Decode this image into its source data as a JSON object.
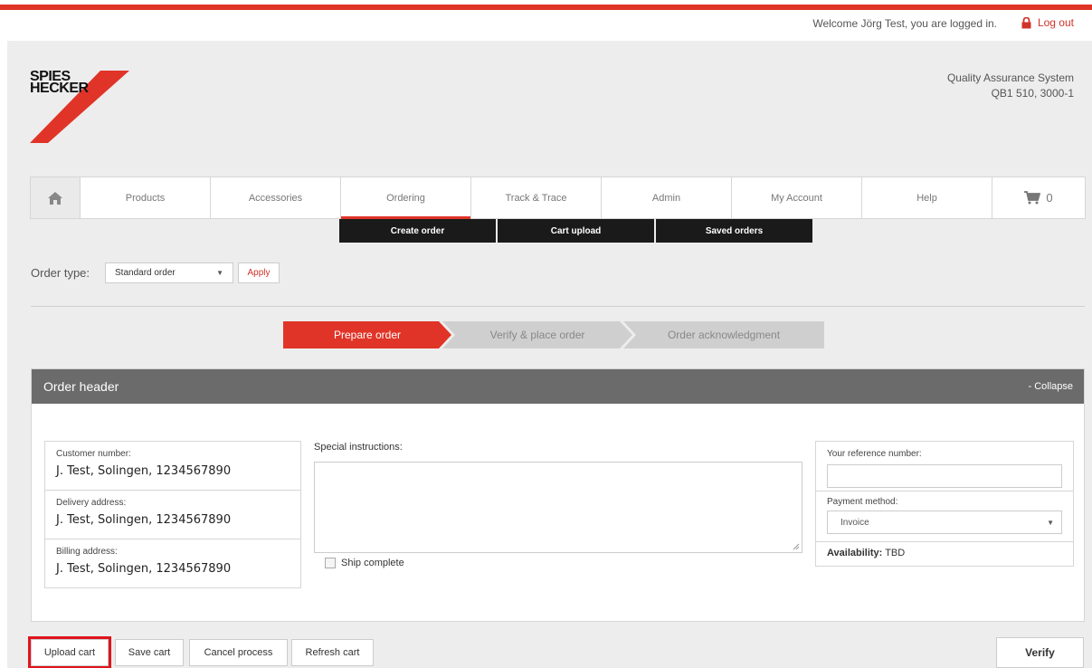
{
  "header": {
    "welcome_text": "Welcome Jörg Test, you are logged in.",
    "logout_label": "Log out",
    "system_title": "Quality Assurance System",
    "system_id": "QB1 510, 3000-1"
  },
  "logo": {
    "line1": "SPIES",
    "line2": "HECKER"
  },
  "nav": {
    "items": [
      "Products",
      "Accessories",
      "Ordering",
      "Track & Trace",
      "Admin",
      "My Account",
      "Help"
    ],
    "cart_count": "0"
  },
  "subnav": [
    "Create order",
    "Cart upload",
    "Saved orders"
  ],
  "order_type": {
    "label": "Order type:",
    "selected": "Standard order",
    "apply_label": "Apply"
  },
  "steps": [
    "Prepare order",
    "Verify & place order",
    "Order acknowledgment"
  ],
  "panel": {
    "title": "Order header",
    "collapse_label": "- Collapse",
    "customer_label": "Customer number:",
    "customer_value": "J. Test, Solingen, 1234567890",
    "delivery_label": "Delivery address:",
    "delivery_value": "J. Test, Solingen, 1234567890",
    "billing_label": "Billing address:",
    "billing_value": "J. Test, Solingen, 1234567890",
    "special_instructions_label": "Special instructions:",
    "ship_complete_label": "Ship complete",
    "reference_label": "Your reference number:",
    "payment_label": "Payment method:",
    "payment_selected": "Invoice",
    "availability_label": "Availability:",
    "availability_value": "TBD"
  },
  "actions": {
    "upload_cart": "Upload cart",
    "save_cart": "Save cart",
    "cancel_process": "Cancel process",
    "refresh_cart": "Refresh cart",
    "verify": "Verify"
  },
  "colors": {
    "accent": "#e03428",
    "nav_dark": "#1a1a1a",
    "panel_header": "#6b6b6b"
  }
}
